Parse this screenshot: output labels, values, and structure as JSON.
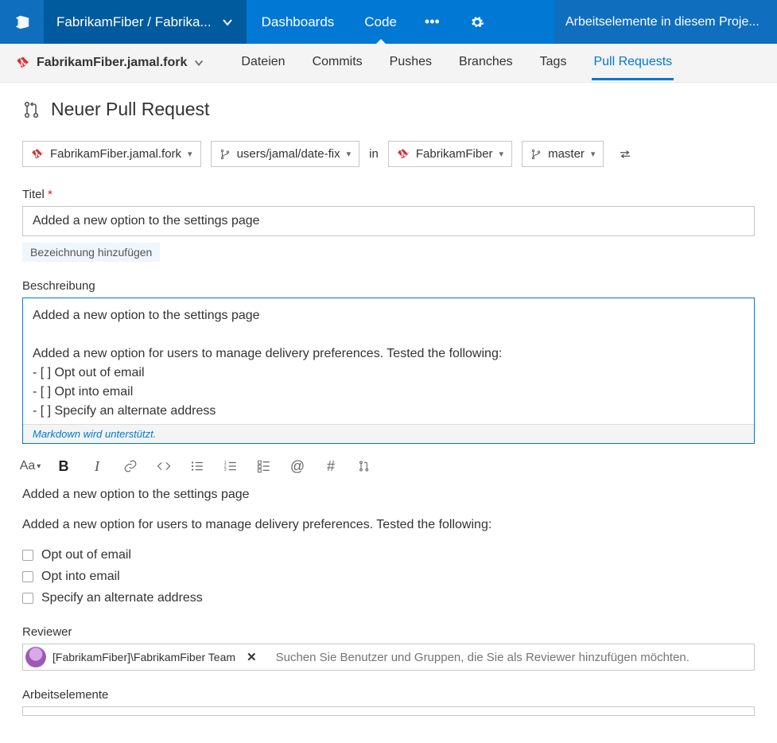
{
  "topbar": {
    "project_breadcrumb": "FabrikamFiber / Fabrika...",
    "nav": {
      "dashboards": "Dashboards",
      "code": "Code"
    },
    "search_placeholder": "Arbeitselemente in diesem Proje..."
  },
  "subbar": {
    "repo": "FabrikamFiber.jamal.fork",
    "tabs": {
      "files": "Dateien",
      "commits": "Commits",
      "pushes": "Pushes",
      "branches": "Branches",
      "tags": "Tags",
      "pull_requests": "Pull Requests"
    }
  },
  "page": {
    "title": "Neuer Pull Request"
  },
  "branches": {
    "source_repo": "FabrikamFiber.jamal.fork",
    "source_branch": "users/jamal/date-fix",
    "in_label": "in",
    "target_repo": "FabrikamFiber",
    "target_branch": "master"
  },
  "title_field": {
    "label": "Titel",
    "value": "Added a new option to the settings page"
  },
  "add_label_chip": "Bezeichnung hinzufügen",
  "description": {
    "label": "Beschreibung",
    "value": "Added a new option to the settings page\n\nAdded a new option for users to manage delivery preferences. Tested the following:\n- [ ] Opt out of email\n- [ ] Opt into email\n- [ ] Specify an alternate address",
    "markdown_hint": "Markdown wird unterstützt."
  },
  "toolbar_font_label": "Aa",
  "preview": {
    "line1": "Added a new option to the settings page",
    "line2": "Added a new option for users to manage delivery preferences. Tested the following:",
    "checks": [
      "Opt out of email",
      "Opt into email",
      "Specify an alternate address"
    ]
  },
  "reviewer": {
    "label": "Reviewer",
    "chip": "[FabrikamFiber]\\FabrikamFiber Team",
    "placeholder": "Suchen Sie Benutzer und Gruppen, die Sie als Reviewer hinzufügen möchten."
  },
  "workitems": {
    "label": "Arbeitselemente"
  }
}
